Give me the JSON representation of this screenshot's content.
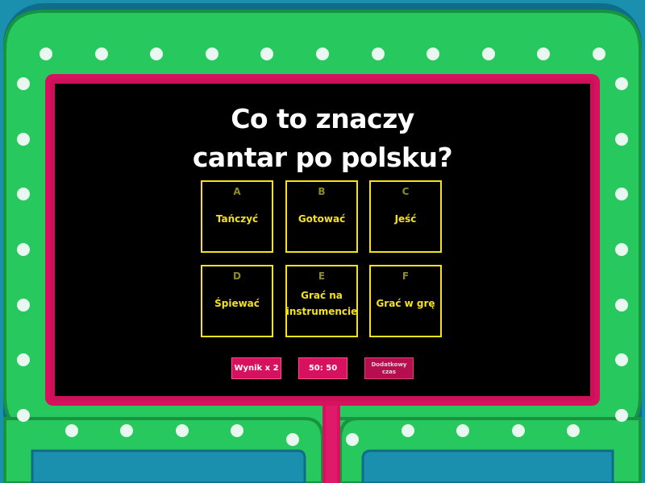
{
  "question": {
    "line1": "Co to znaczy",
    "line2": "cantar po polsku?"
  },
  "answers": [
    {
      "letter": "A",
      "text": "Tańczyć"
    },
    {
      "letter": "B",
      "text": "Gotować"
    },
    {
      "letter": "C",
      "text": "Jeść"
    },
    {
      "letter": "D",
      "text": "Śpiewać"
    },
    {
      "letter": "E",
      "text": "Grać na instrumencie"
    },
    {
      "letter": "F",
      "text": "Grać w grę"
    }
  ],
  "lifelines": {
    "double_score": "Wynik x 2",
    "fifty_fifty": "50: 50",
    "extra_time": "Dodatkowy czas"
  },
  "colors": {
    "background": "#1a8fae",
    "frame_green": "#27c85e",
    "frame_border": "#17943f",
    "bulb": "#e8f7ef",
    "inner_frame": "#d8115f",
    "screen": "#000000",
    "answer_yellow": "#f5e31a"
  }
}
